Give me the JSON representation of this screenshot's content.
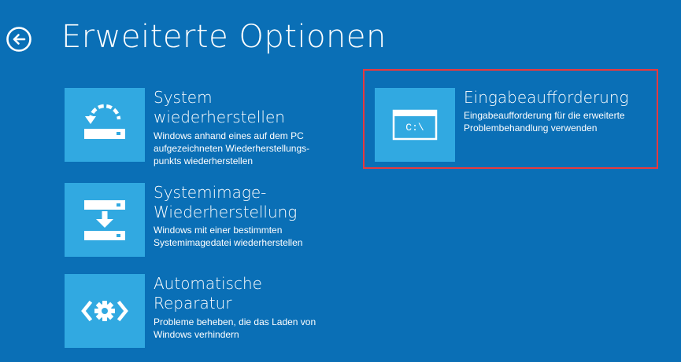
{
  "header": {
    "title": "Erweiterte Optionen",
    "back_icon": "back-arrow-circle-icon"
  },
  "options": [
    {
      "id": "system-restore",
      "icon": "system-restore-icon",
      "title": "System\nwiederherstellen",
      "description": "Windows anhand eines auf dem PC\naufgezeichneten Wiederherstellungs-\npunkts wiederherstellen"
    },
    {
      "id": "system-image",
      "icon": "system-image-recovery-icon",
      "title": "Systemimage-\nWiederherstellung",
      "description": "Windows mit einer bestimmten\nSystemimagedatei wiederherstellen"
    },
    {
      "id": "auto-repair",
      "icon": "startup-repair-gear-icon",
      "title": "Automatische\nReparatur",
      "description": "Probleme beheben, die das Laden von\nWindows verhindern"
    },
    {
      "id": "cmd",
      "icon": "command-prompt-icon",
      "title": "Eingabeaufforderung",
      "description": "Eingabeaufforderung für die erweiterte\nProblembehandlung verwenden",
      "icon_text": "C:\\",
      "highlighted": true
    }
  ],
  "colors": {
    "background": "#0a6fb6",
    "tile": "#31a9e1",
    "highlight": "#e8393e",
    "text": "#ffffff"
  }
}
